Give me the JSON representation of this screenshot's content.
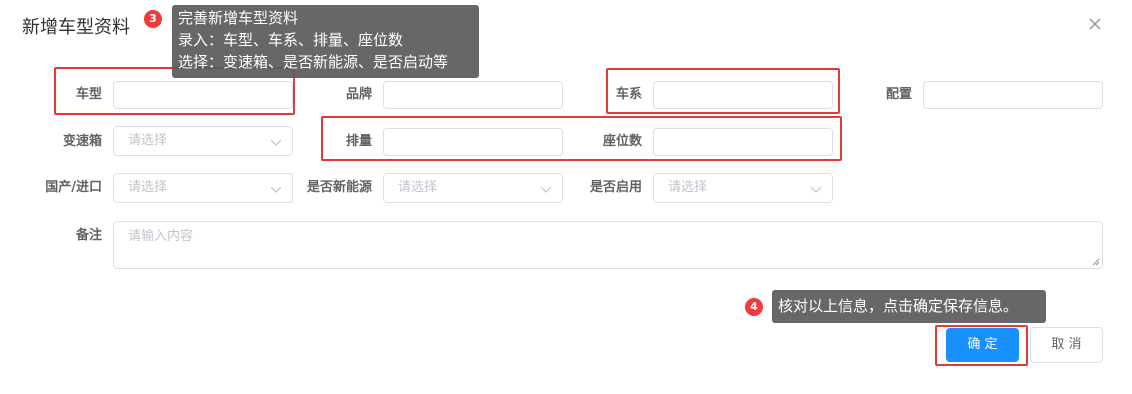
{
  "dialog": {
    "title": "新增车型资料"
  },
  "form": {
    "model_label": "车型",
    "brand_label": "品牌",
    "series_label": "车系",
    "config_label": "配置",
    "gearbox_label": "变速箱",
    "gearbox_placeholder": "请选择",
    "displacement_label": "排量",
    "seats_label": "座位数",
    "origin_label": "国产/进口",
    "origin_placeholder": "请选择",
    "new_energy_label": "是否新能源",
    "new_energy_placeholder": "请选择",
    "enabled_label": "是否启用",
    "enabled_placeholder": "请选择",
    "remark_label": "备注",
    "remark_placeholder": "请输入内容"
  },
  "callouts": {
    "step3": {
      "badge": "3",
      "lines": [
        "完善新增车型资料",
        "录入：车型、车系、排量、座位数",
        "选择：变速箱、是否新能源、是否启动等"
      ]
    },
    "step4": {
      "badge": "4",
      "text": "核对以上信息，点击确定保存信息。"
    }
  },
  "buttons": {
    "confirm": "确 定",
    "cancel": "取 消"
  },
  "colors": {
    "primary": "#1890ff",
    "highlight": "#e53935",
    "badge": "#f23a3a"
  }
}
